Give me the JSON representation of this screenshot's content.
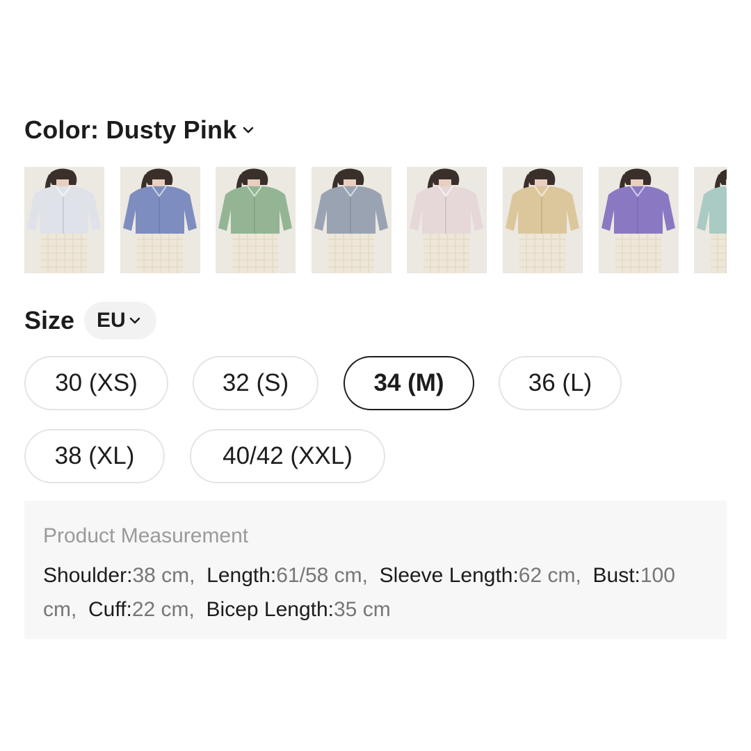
{
  "color": {
    "prefix": "Color: ",
    "value": "Dusty Pink",
    "swatches": [
      {
        "name": "white",
        "shirt": "#dfe2e8"
      },
      {
        "name": "blue",
        "shirt": "#7e8dbf"
      },
      {
        "name": "green",
        "shirt": "#93b594"
      },
      {
        "name": "gray-blue",
        "shirt": "#9aa3b1"
      },
      {
        "name": "dusty-pink",
        "shirt": "#e6d8d9"
      },
      {
        "name": "beige",
        "shirt": "#dcc79d"
      },
      {
        "name": "purple",
        "shirt": "#8a79c2"
      },
      {
        "name": "mint",
        "shirt": "#a9cbc3"
      }
    ]
  },
  "size": {
    "title": "Size",
    "unit": "EU",
    "options": [
      "30 (XS)",
      "32 (S)",
      "34 (M)",
      "36 (L)",
      "38 (XL)",
      "40/42 (XXL)"
    ],
    "selected": "34 (M)"
  },
  "measurement": {
    "title": "Product Measurement",
    "items": [
      {
        "key": "Shoulder:",
        "value": "38 cm,"
      },
      {
        "key": "Length:",
        "value": "61/58 cm,"
      },
      {
        "key": "Sleeve Length:",
        "value": "62 cm,"
      },
      {
        "key": "Bust:",
        "value": "100 cm,"
      },
      {
        "key": "Cuff:",
        "value": "22 cm,"
      },
      {
        "key": "Bicep Length:",
        "value": "35 cm"
      }
    ]
  }
}
